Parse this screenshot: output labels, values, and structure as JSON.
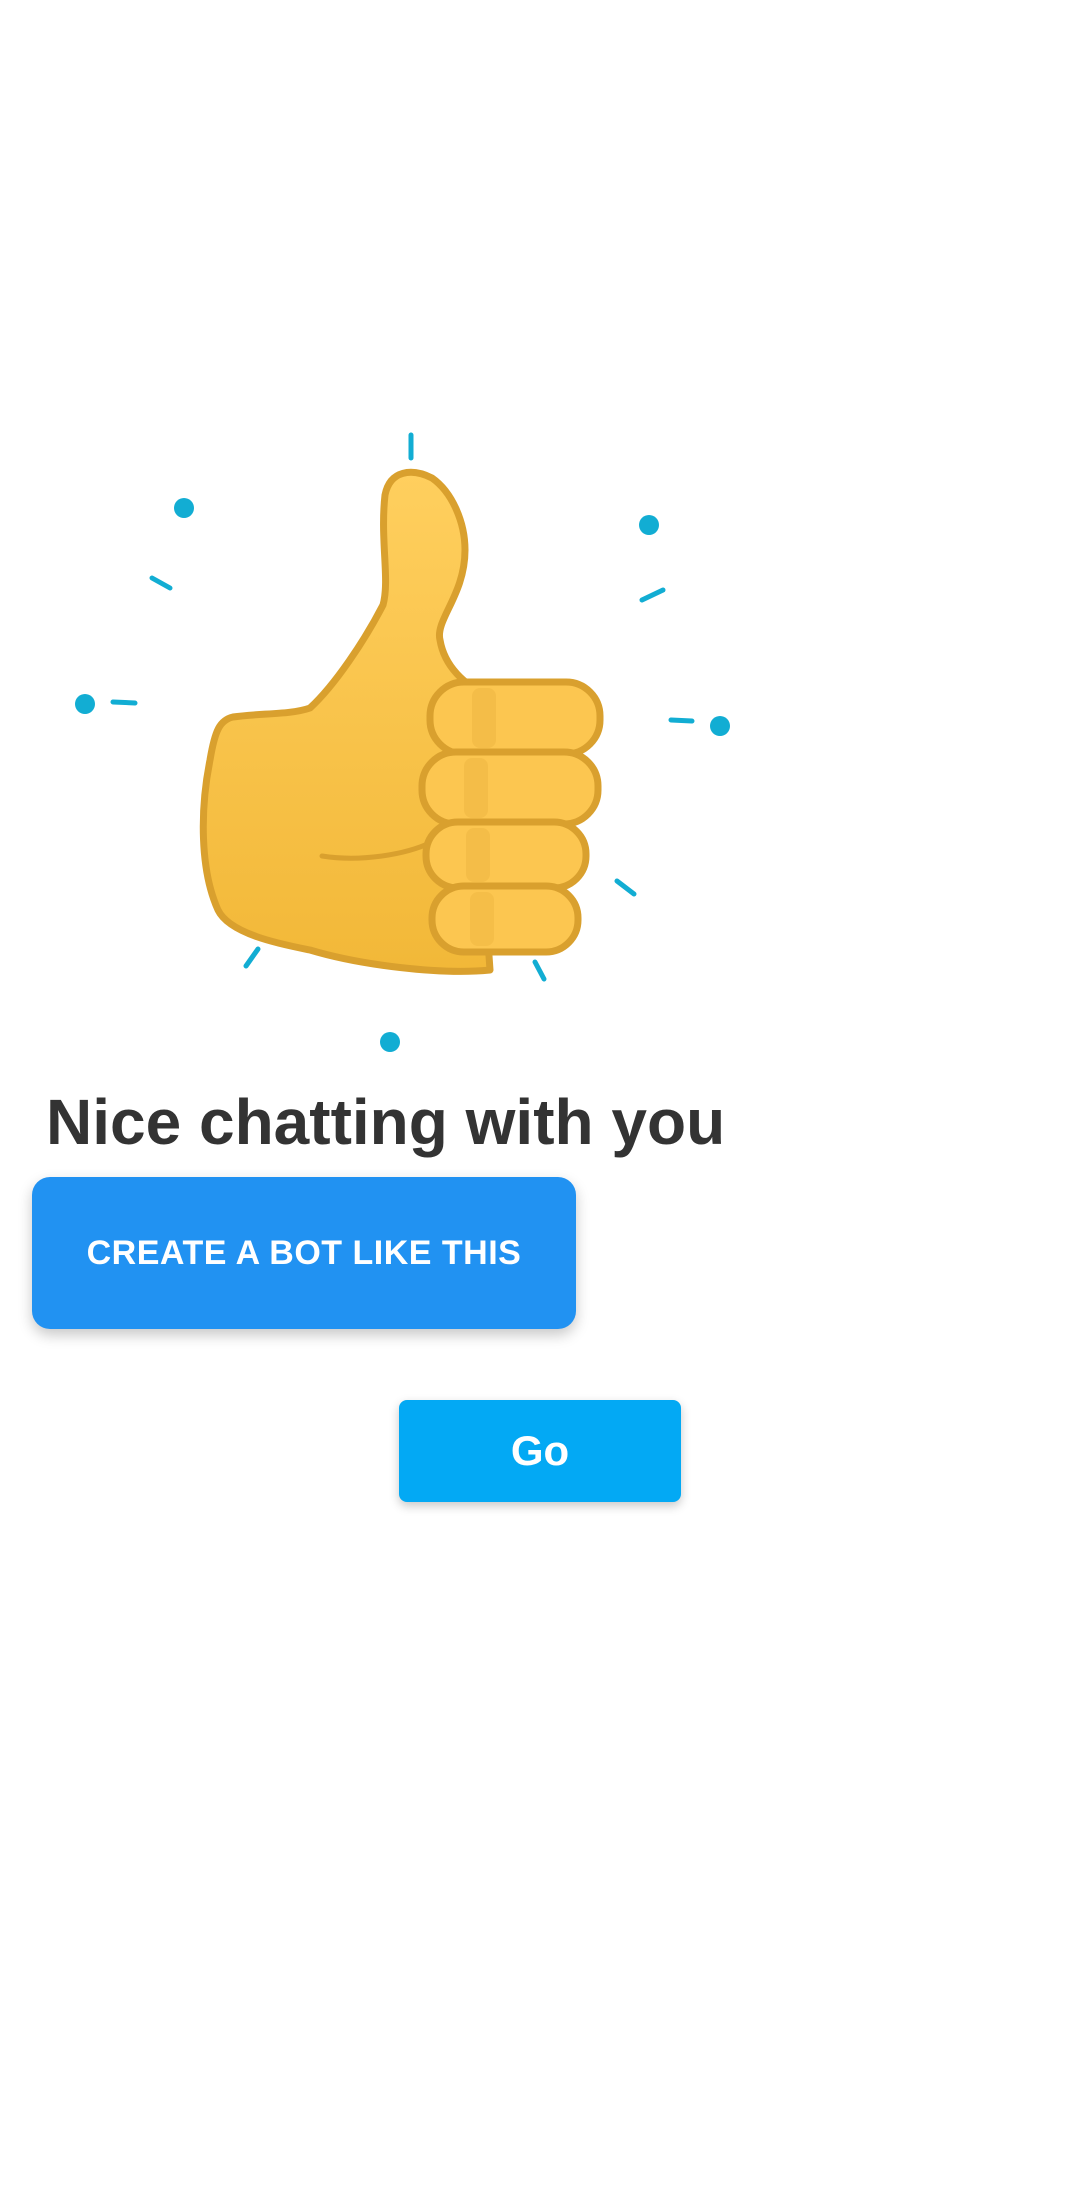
{
  "app": {
    "background_color": "#ffffff"
  },
  "illustration": {
    "icon": "thumbs-up-icon",
    "fill_color": "#FBC649",
    "outline_color": "#D9A02E",
    "sparkle_color": "#12ADD3"
  },
  "headline": {
    "text": "Nice chatting with you",
    "color": "#333333"
  },
  "create_bot_button": {
    "label": "CREATE A BOT LIKE THIS",
    "color": "#2192F2"
  },
  "go_button": {
    "label": "Go",
    "color": "#03A9F4"
  }
}
